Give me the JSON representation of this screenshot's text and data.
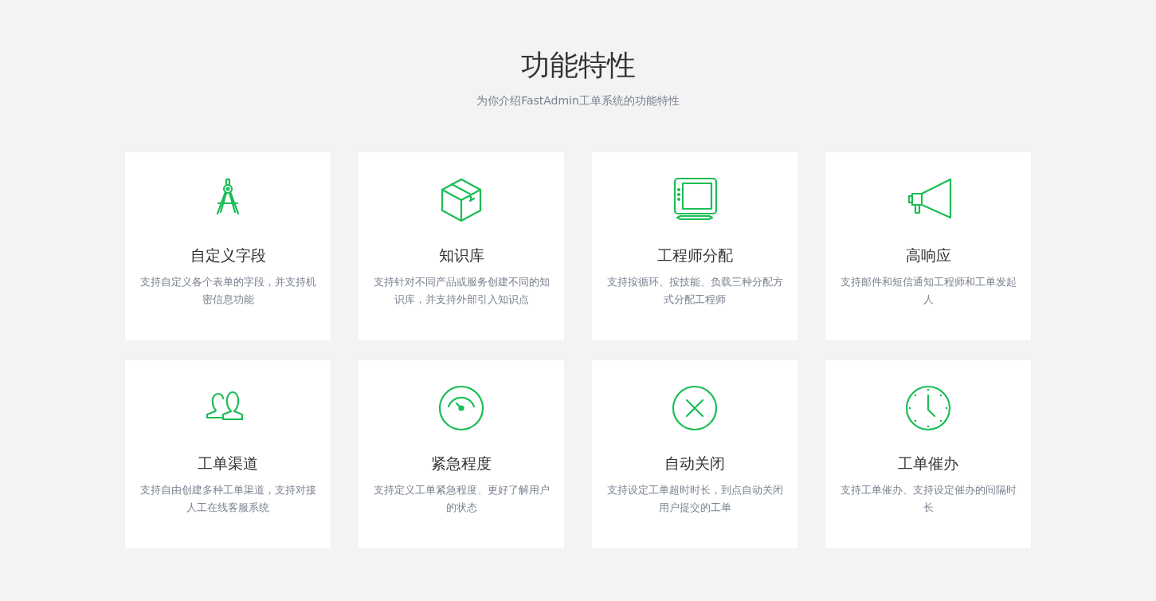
{
  "header": {
    "title": "功能特性",
    "subtitle": "为你介绍FastAdmin工单系统的功能特性"
  },
  "features": [
    {
      "title": "自定义字段",
      "description": "支持自定义各个表单的字段，并支持机密信息功能"
    },
    {
      "title": "知识库",
      "description": "支持针对不同产品或服务创建不同的知识库，并支持外部引入知识点"
    },
    {
      "title": "工程师分配",
      "description": "支持按循环、按技能、负载三种分配方式分配工程师"
    },
    {
      "title": "高响应",
      "description": "支持邮件和短信通知工程师和工单发起人"
    },
    {
      "title": "工单渠道",
      "description": "支持自由创建多种工单渠道，支持对接人工在线客服系统"
    },
    {
      "title": "紧急程度",
      "description": "支持定义工单紧急程度、更好了解用户的状态"
    },
    {
      "title": "自动关闭",
      "description": "支持设定工单超时时长，到点自动关闭用户提交的工单"
    },
    {
      "title": "工单催办",
      "description": "支持工单催办、支持设定催办的间隔时长"
    }
  ]
}
